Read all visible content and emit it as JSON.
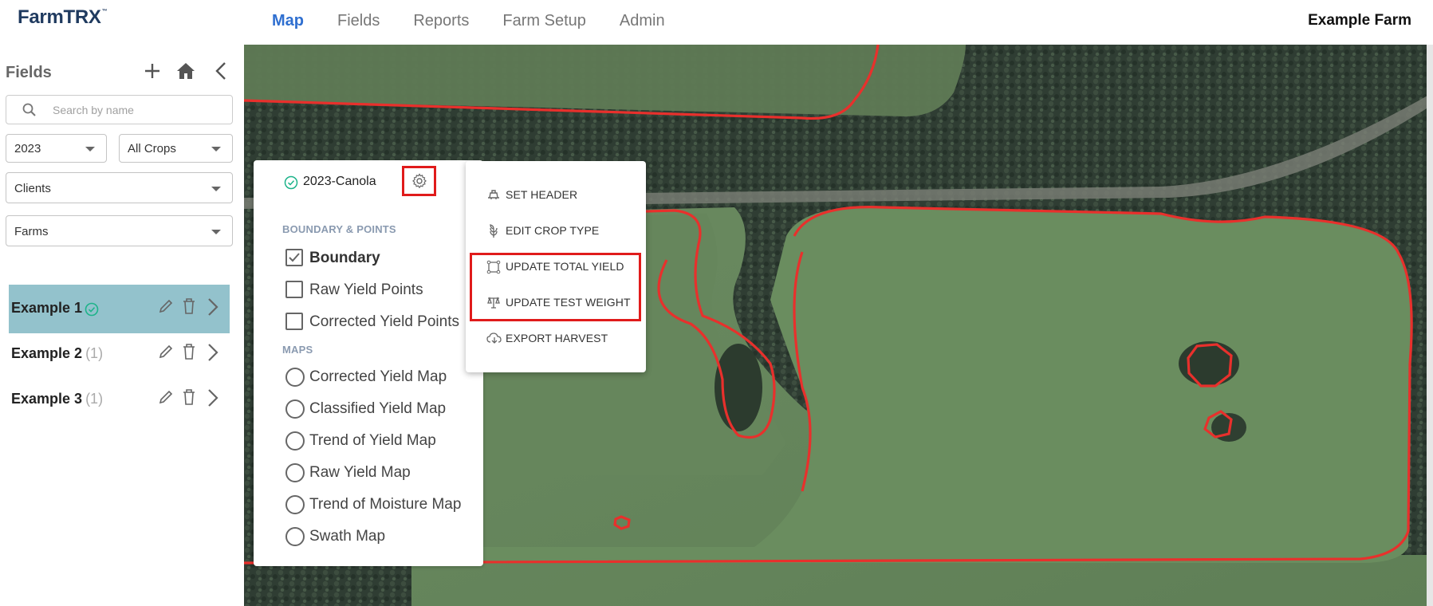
{
  "app": {
    "logo": "FarmTRX",
    "logo_mark": "™",
    "farm_name": "Example Farm"
  },
  "nav": [
    {
      "label": "Map",
      "active": true
    },
    {
      "label": "Fields",
      "active": false
    },
    {
      "label": "Reports",
      "active": false
    },
    {
      "label": "Farm Setup",
      "active": false
    },
    {
      "label": "Admin",
      "active": false
    }
  ],
  "sidebar": {
    "title": "Fields",
    "search_placeholder": "Search by name",
    "year": "2023",
    "crop": "All Crops",
    "clients": "Clients",
    "farms": "Farms",
    "fields": [
      {
        "name": "Example 1",
        "count": "",
        "selected": true
      },
      {
        "name": "Example 2",
        "count": "(1)",
        "selected": false
      },
      {
        "name": "Example 3",
        "count": "(1)",
        "selected": false
      }
    ]
  },
  "panel": {
    "title": "2023-Canola",
    "section_boundary": "BOUNDARY & POINTS",
    "section_maps": "MAPS",
    "layers": [
      {
        "label": "Boundary",
        "checked": true
      },
      {
        "label": "Raw Yield Points",
        "checked": false
      },
      {
        "label": "Corrected Yield Points",
        "checked": false
      }
    ],
    "maps": [
      {
        "label": "Corrected Yield Map"
      },
      {
        "label": "Classified Yield Map"
      },
      {
        "label": "Trend of Yield Map"
      },
      {
        "label": "Raw Yield Map"
      },
      {
        "label": "Trend of Moisture Map"
      },
      {
        "label": "Swath Map"
      }
    ]
  },
  "menu": {
    "items": [
      {
        "label": "SET HEADER",
        "icon": "header-icon"
      },
      {
        "label": "EDIT CROP TYPE",
        "icon": "crop-icon"
      },
      {
        "label": "UPDATE TOTAL YIELD",
        "icon": "polygon-icon"
      },
      {
        "label": "UPDATE TEST WEIGHT",
        "icon": "scale-icon"
      },
      {
        "label": "EXPORT HARVEST",
        "icon": "cloud-download-icon"
      }
    ]
  },
  "colors": {
    "accent": "#2f6fd0",
    "selected_row": "#93c2cc",
    "boundary": "#e8302c",
    "highlight": "#e01b1b",
    "check_green": "#1db38a"
  }
}
